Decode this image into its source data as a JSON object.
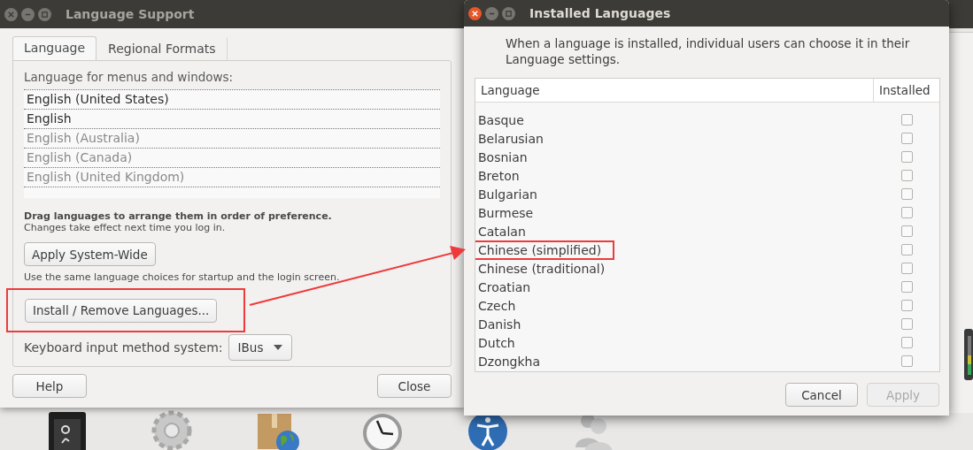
{
  "language_support": {
    "title": "Language Support",
    "tabs": [
      {
        "label": "Language",
        "selected": true
      },
      {
        "label": "Regional Formats",
        "selected": false
      }
    ],
    "list_label": "Language for menus and windows:",
    "languages": [
      {
        "name": "English (United States)",
        "active": true
      },
      {
        "name": "English",
        "active": true
      },
      {
        "name": "English (Australia)",
        "active": false
      },
      {
        "name": "English (Canada)",
        "active": false
      },
      {
        "name": "English (United Kingdom)",
        "active": false
      }
    ],
    "drag_hint": "Drag languages to arrange them in order of preference.",
    "effect_hint": "Changes take effect next time you log in.",
    "apply_button": "Apply System-Wide",
    "apply_hint": "Use the same language choices for startup and the login screen.",
    "install_button": {
      "label": "Install / Remove Languages...",
      "highlighted": true
    },
    "input_method_label": "Keyboard input method system:",
    "input_method_value": "IBus",
    "help_button": "Help",
    "close_button": "Close"
  },
  "installed_languages": {
    "title": "Installed Languages",
    "description": "When a language is installed, individual users can choose it in their Language settings.",
    "columns": [
      "Language",
      "Installed"
    ],
    "rows": [
      {
        "name": "Basque",
        "installed": false,
        "highlighted": false
      },
      {
        "name": "Belarusian",
        "installed": false,
        "highlighted": false
      },
      {
        "name": "Bosnian",
        "installed": false,
        "highlighted": false
      },
      {
        "name": "Breton",
        "installed": false,
        "highlighted": false
      },
      {
        "name": "Bulgarian",
        "installed": false,
        "highlighted": false
      },
      {
        "name": "Burmese",
        "installed": false,
        "highlighted": false
      },
      {
        "name": "Catalan",
        "installed": false,
        "highlighted": false
      },
      {
        "name": "Chinese (simplified)",
        "installed": false,
        "highlighted": true
      },
      {
        "name": "Chinese (traditional)",
        "installed": false,
        "highlighted": false
      },
      {
        "name": "Croatian",
        "installed": false,
        "highlighted": false
      },
      {
        "name": "Czech",
        "installed": false,
        "highlighted": false
      },
      {
        "name": "Danish",
        "installed": false,
        "highlighted": false
      },
      {
        "name": "Dutch",
        "installed": false,
        "highlighted": false
      },
      {
        "name": "Dzongkha",
        "installed": false,
        "highlighted": false
      }
    ],
    "cancel_button": "Cancel",
    "apply_button": {
      "label": "Apply",
      "disabled": true
    }
  }
}
